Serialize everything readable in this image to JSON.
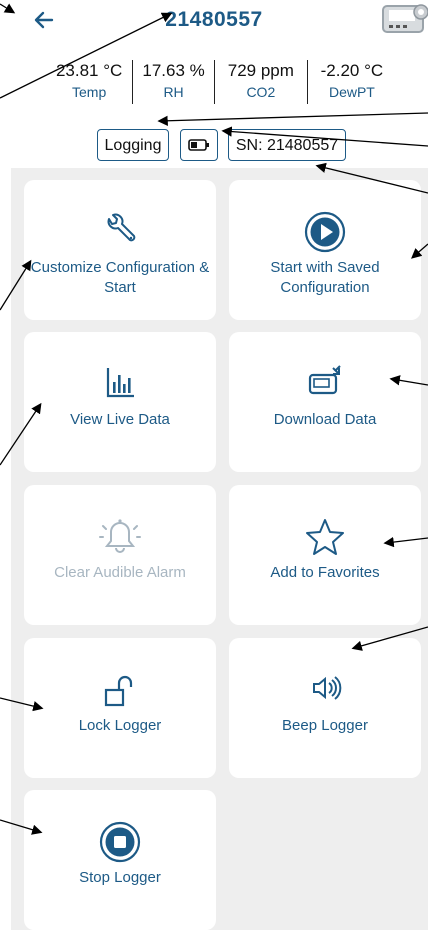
{
  "header": {
    "title": "21480557"
  },
  "readings": [
    {
      "value": "23.81 °C",
      "label": "Temp"
    },
    {
      "value": "17.63 %",
      "label": "RH"
    },
    {
      "value": "729 ppm",
      "label": "CO2"
    },
    {
      "value": "-2.20 °C",
      "label": "DewPT"
    }
  ],
  "status": {
    "logging": "Logging",
    "serial": "SN: 21480557"
  },
  "tiles": {
    "customize": "Customize Configuration & Start",
    "start_saved": "Start with Saved Configuration",
    "view_live": "View Live Data",
    "download": "Download Data",
    "clear_alarm": "Clear Audible Alarm",
    "favorites": "Add to Favorites",
    "lock": "Lock Logger",
    "beep": "Beep Logger",
    "stop": "Stop Logger"
  },
  "icons": [
    "back-arrow-icon",
    "device-icon",
    "battery-icon",
    "wrench-icon",
    "play-icon",
    "bar-chart-icon",
    "download-device-icon",
    "bell-icon",
    "star-icon",
    "unlock-icon",
    "speaker-icon",
    "stop-icon"
  ],
  "colors": {
    "accent": "#1d5a86",
    "disabled": "#a8b6c1",
    "grid_bg": "#eeeeee"
  }
}
